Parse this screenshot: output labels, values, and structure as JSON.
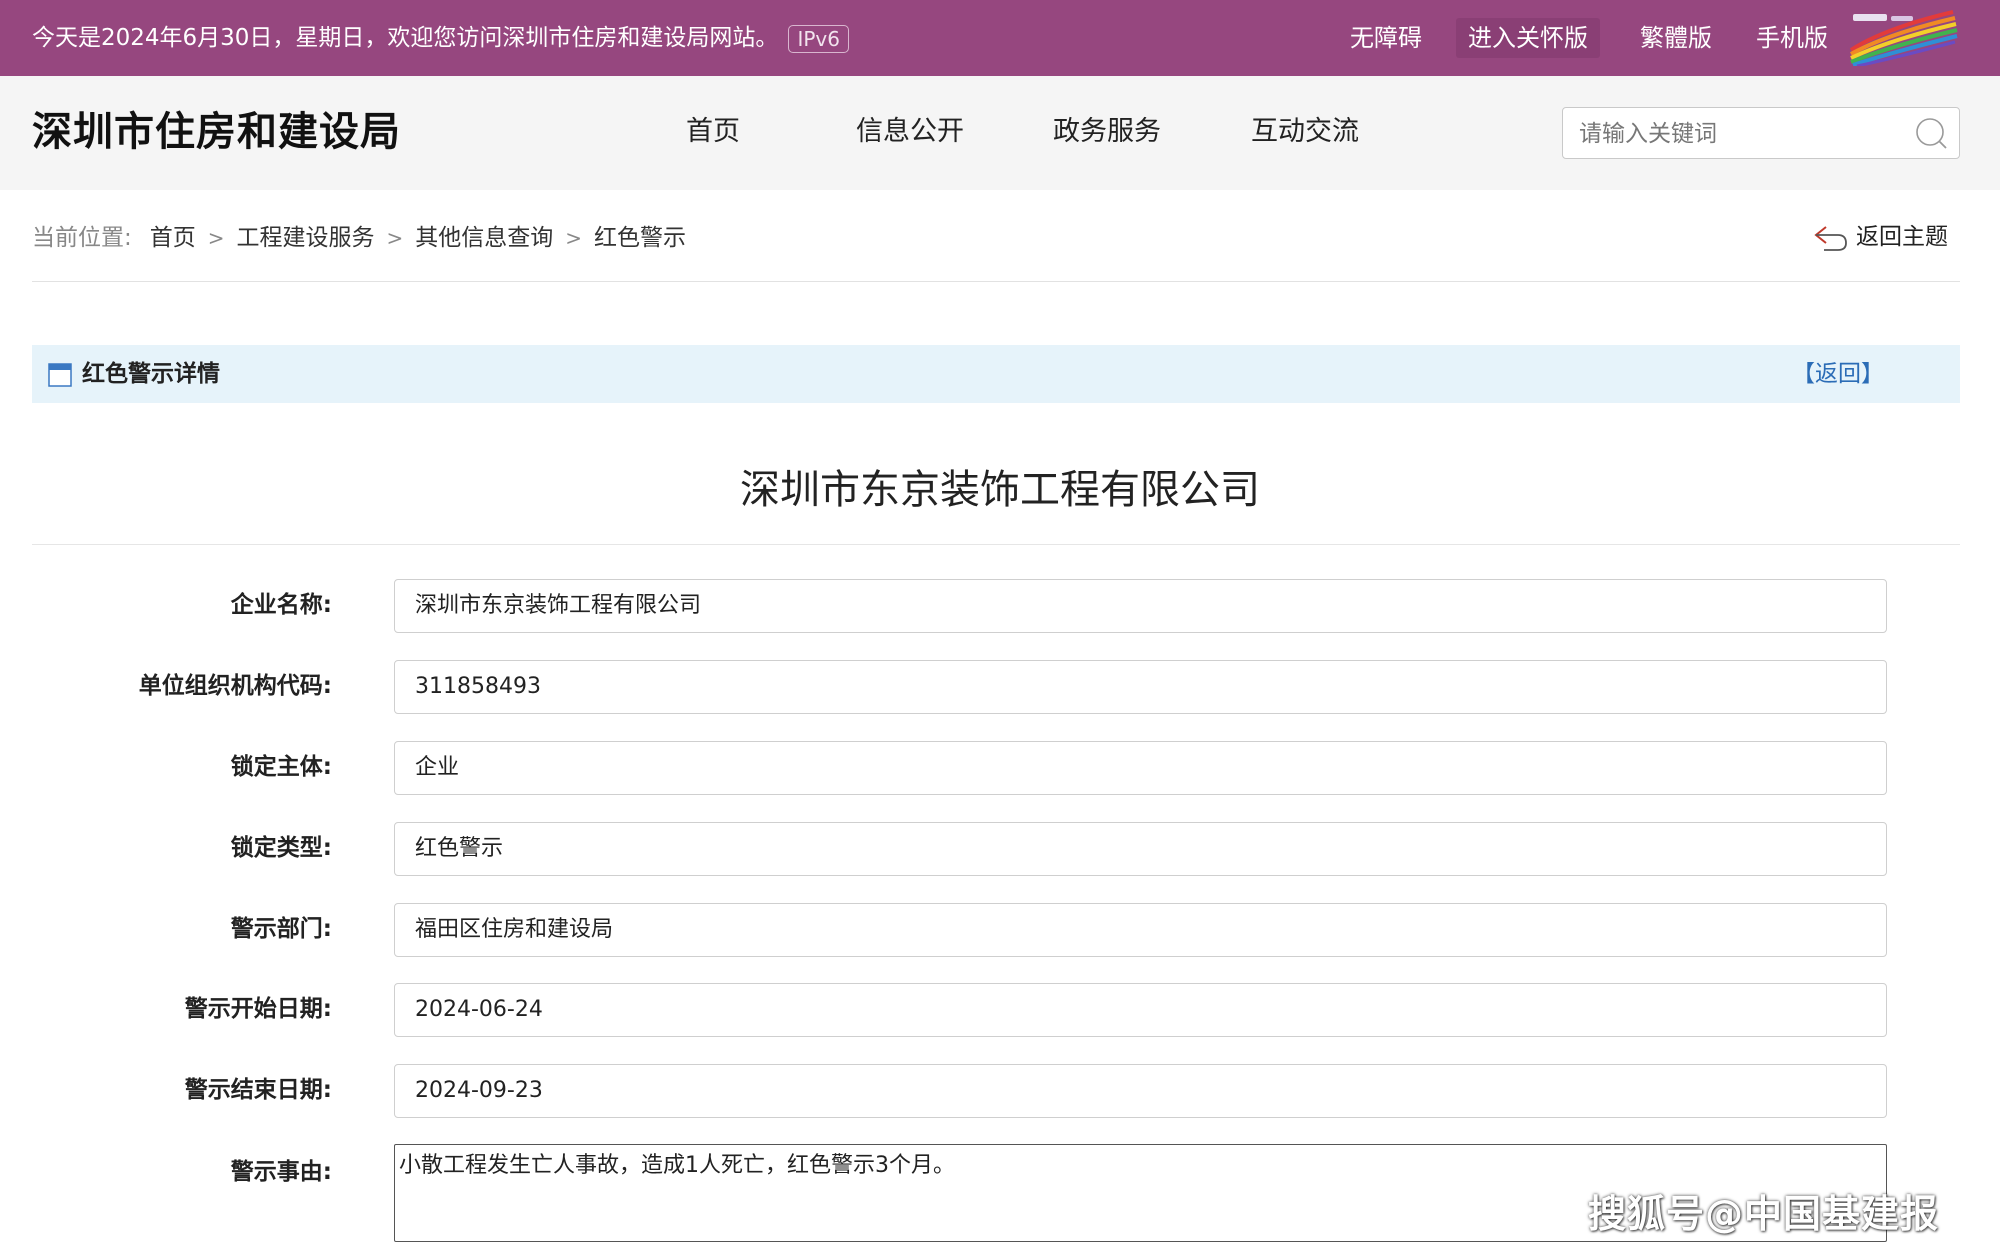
{
  "topbar": {
    "welcome": "今天是2024年6月30日，星期日，欢迎您访问深圳市住房和建设局网站。",
    "ipv6_badge": "IPv6",
    "links": {
      "accessibility": "无障碍",
      "care_mode": "进入关怀版",
      "traditional": "繁體版",
      "mobile": "手机版"
    }
  },
  "header": {
    "site_title": "深圳市住房和建设局",
    "nav": {
      "home": "首页",
      "info": "信息公开",
      "service": "政务服务",
      "interact": "互动交流"
    },
    "search_placeholder": "请输入关键词"
  },
  "breadcrumb": {
    "label": "当前位置:",
    "items": [
      "首页",
      "工程建设服务",
      "其他信息查询",
      "红色警示"
    ],
    "separator": ">",
    "back_theme": "返回主题"
  },
  "panel": {
    "title": "红色警示详情",
    "back": "【返回】"
  },
  "company_heading": "深圳市东京装饰工程有限公司",
  "form": {
    "enterprise_name": {
      "label": "企业名称:",
      "value": "深圳市东京装饰工程有限公司"
    },
    "org_code": {
      "label": "单位组织机构代码:",
      "value": "311858493"
    },
    "lock_subject": {
      "label": "锁定主体:",
      "value": "企业"
    },
    "lock_type": {
      "label": "锁定类型:",
      "value": "红色警示"
    },
    "warning_dept": {
      "label": "警示部门:",
      "value": "福田区住房和建设局"
    },
    "start_date": {
      "label": "警示开始日期:",
      "value": "2024-06-24"
    },
    "end_date": {
      "label": "警示结束日期:",
      "value": "2024-09-23"
    },
    "reason": {
      "label": "警示事由:",
      "value": "小散工程发生亡人事故，造成1人死亡，红色警示3个月。"
    }
  },
  "watermark": "搜狐号@中国基建报",
  "colors": {
    "topbar_bg": "#96477f",
    "header_bg": "#f5f5f5",
    "panel_bg": "#e6f3fa",
    "link_blue": "#2b6cb6"
  }
}
